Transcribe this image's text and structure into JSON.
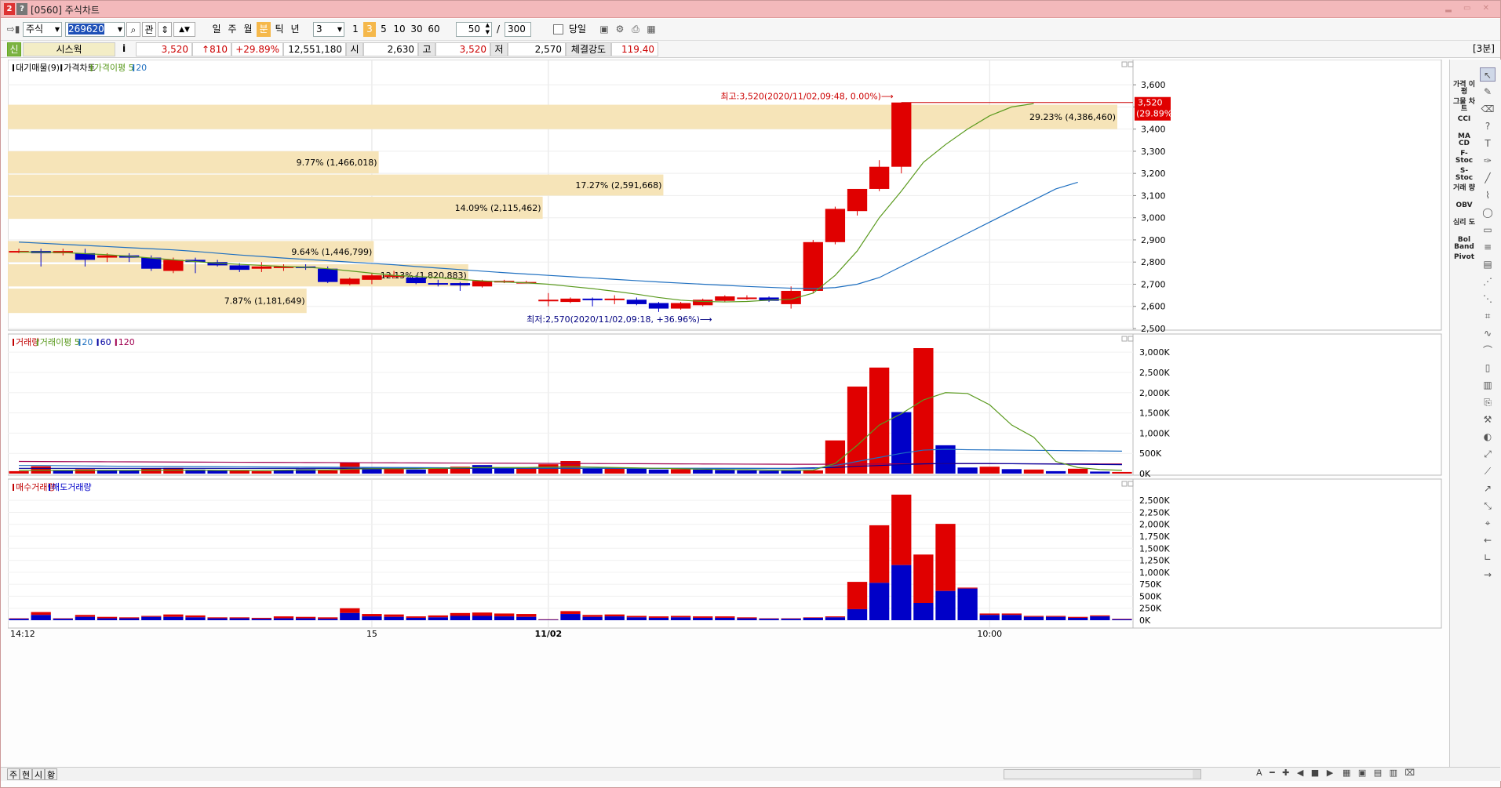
{
  "window": {
    "title": "[0560] 주식차트",
    "icon1": "2",
    "icon2": "?"
  },
  "toolbar": {
    "market": "주식",
    "code": "269620",
    "btn_kwan": "관",
    "periods": [
      "일",
      "주",
      "월",
      "분",
      "틱",
      "년"
    ],
    "period_selected": "분",
    "interval": "3",
    "minute_opts": [
      "1",
      "3",
      "5",
      "10",
      "30",
      "60"
    ],
    "minute_selected": "3",
    "display_count": "50",
    "slash": "/",
    "total_count": "300",
    "today_label": "당일"
  },
  "info": {
    "badge": "신",
    "name": "시스웍",
    "info_icon": "i",
    "price": "3,520",
    "change": "↑810",
    "change_pct": "+29.89%",
    "volume": "12,551,180",
    "open_label": "시",
    "open": "2,630",
    "high_label": "고",
    "high": "3,520",
    "low_label": "저",
    "low": "2,570",
    "strength_label": "체결강도",
    "strength": "119.40",
    "timeframe": "[3분]"
  },
  "chart_data": [
    {
      "type": "candlestick",
      "legend": [
        {
          "name": "대기매물(9)",
          "color": "#000000"
        },
        {
          "name": "가격차트",
          "color": "#000000"
        },
        {
          "name": "가격이평 5",
          "color": "#5a9a1e"
        },
        {
          "name": "20",
          "color": "#1e6fc0"
        }
      ],
      "ylim": [
        2500,
        3650
      ],
      "yticks": [
        "3,600",
        "3,500",
        "3,400",
        "3,300",
        "3,200",
        "3,100",
        "3,000",
        "2,900",
        "2,800",
        "2,700",
        "2,600",
        "2,500"
      ],
      "last_price_label": "3,520",
      "last_pct_label": "(29.89%)",
      "high_annotation": "최고:3,520(2020/11/02,09:48, 0.00%)⟶",
      "low_annotation": "최저:2,570(2020/11/02,09:18, +36.96%)⟶",
      "volume_profile": [
        {
          "label": "29.23% (4,386,460)",
          "low": 3400,
          "high": 3510
        },
        {
          "label": "9.77% (1,466,018)",
          "low": 3200,
          "high": 3300
        },
        {
          "label": "17.27% (2,591,668)",
          "low": 3100,
          "high": 3195
        },
        {
          "label": "14.09% (2,115,462)",
          "low": 2995,
          "high": 3095
        },
        {
          "label": "9.64% (1,446,799)",
          "low": 2800,
          "high": 2895
        },
        {
          "label": "12.13% (1,820,883)",
          "low": 2690,
          "high": 2790
        },
        {
          "label": "7.87% (1,181,649)",
          "low": 2570,
          "high": 2680
        }
      ],
      "candles": [
        {
          "o": 2850,
          "h": 2860,
          "l": 2840,
          "c": 2850
        },
        {
          "o": 2850,
          "h": 2860,
          "l": 2780,
          "c": 2840
        },
        {
          "o": 2840,
          "h": 2860,
          "l": 2830,
          "c": 2850
        },
        {
          "o": 2840,
          "h": 2860,
          "l": 2780,
          "c": 2810
        },
        {
          "o": 2820,
          "h": 2840,
          "l": 2800,
          "c": 2830
        },
        {
          "o": 2830,
          "h": 2840,
          "l": 2800,
          "c": 2820
        },
        {
          "o": 2820,
          "h": 2830,
          "l": 2760,
          "c": 2770
        },
        {
          "o": 2760,
          "h": 2820,
          "l": 2750,
          "c": 2810
        },
        {
          "o": 2810,
          "h": 2820,
          "l": 2750,
          "c": 2800
        },
        {
          "o": 2800,
          "h": 2810,
          "l": 2780,
          "c": 2785
        },
        {
          "o": 2785,
          "h": 2795,
          "l": 2755,
          "c": 2765
        },
        {
          "o": 2770,
          "h": 2800,
          "l": 2755,
          "c": 2780
        },
        {
          "o": 2780,
          "h": 2790,
          "l": 2760,
          "c": 2780
        },
        {
          "o": 2780,
          "h": 2790,
          "l": 2765,
          "c": 2775
        },
        {
          "o": 2770,
          "h": 2780,
          "l": 2705,
          "c": 2710
        },
        {
          "o": 2700,
          "h": 2730,
          "l": 2695,
          "c": 2725
        },
        {
          "o": 2720,
          "h": 2750,
          "l": 2700,
          "c": 2740
        },
        {
          "o": 2735,
          "h": 2760,
          "l": 2725,
          "c": 2740
        },
        {
          "o": 2730,
          "h": 2740,
          "l": 2700,
          "c": 2705
        },
        {
          "o": 2705,
          "h": 2720,
          "l": 2690,
          "c": 2700
        },
        {
          "o": 2705,
          "h": 2710,
          "l": 2670,
          "c": 2695
        },
        {
          "o": 2690,
          "h": 2720,
          "l": 2685,
          "c": 2715
        },
        {
          "o": 2710,
          "h": 2720,
          "l": 2705,
          "c": 2715
        },
        {
          "o": 2710,
          "h": 2715,
          "l": 2705,
          "c": 2710
        },
        {
          "o": 2630,
          "h": 2660,
          "l": 2600,
          "c": 2630
        },
        {
          "o": 2620,
          "h": 2640,
          "l": 2615,
          "c": 2635
        },
        {
          "o": 2635,
          "h": 2640,
          "l": 2600,
          "c": 2630
        },
        {
          "o": 2635,
          "h": 2650,
          "l": 2610,
          "c": 2635
        },
        {
          "o": 2630,
          "h": 2640,
          "l": 2605,
          "c": 2610
        },
        {
          "o": 2615,
          "h": 2620,
          "l": 2575,
          "c": 2590
        },
        {
          "o": 2590,
          "h": 2620,
          "l": 2585,
          "c": 2615
        },
        {
          "o": 2605,
          "h": 2635,
          "l": 2600,
          "c": 2630
        },
        {
          "o": 2625,
          "h": 2650,
          "l": 2620,
          "c": 2645
        },
        {
          "o": 2640,
          "h": 2650,
          "l": 2630,
          "c": 2640
        },
        {
          "o": 2640,
          "h": 2645,
          "l": 2620,
          "c": 2625
        },
        {
          "o": 2610,
          "h": 2690,
          "l": 2590,
          "c": 2670
        },
        {
          "o": 2670,
          "h": 2900,
          "l": 2660,
          "c": 2890
        },
        {
          "o": 2890,
          "h": 3050,
          "l": 2880,
          "c": 3040
        },
        {
          "o": 3030,
          "h": 3120,
          "l": 3010,
          "c": 3130
        },
        {
          "o": 3130,
          "h": 3260,
          "l": 3120,
          "c": 3230
        },
        {
          "o": 3230,
          "h": 3520,
          "l": 3200,
          "c": 3520
        }
      ],
      "ma5": [
        2845,
        2845,
        2843,
        2838,
        2833,
        2826,
        2818,
        2810,
        2802,
        2795,
        2790,
        2785,
        2780,
        2777,
        2770,
        2760,
        2750,
        2740,
        2735,
        2730,
        2722,
        2715,
        2710,
        2706,
        2700,
        2690,
        2680,
        2668,
        2655,
        2640,
        2628,
        2622,
        2620,
        2622,
        2628,
        2632,
        2660,
        2740,
        2850,
        3000,
        3120,
        3250,
        3330,
        3400,
        3460,
        3500,
        3515
      ],
      "ma20": [
        2890,
        2885,
        2880,
        2875,
        2870,
        2865,
        2860,
        2855,
        2848,
        2840,
        2832,
        2825,
        2818,
        2812,
        2806,
        2800,
        2794,
        2788,
        2780,
        2773,
        2766,
        2759,
        2752,
        2746,
        2740,
        2734,
        2728,
        2722,
        2716,
        2710,
        2705,
        2700,
        2695,
        2690,
        2686,
        2682,
        2680,
        2685,
        2700,
        2730,
        2780,
        2830,
        2880,
        2930,
        2980,
        3030,
        3080,
        3130,
        3160
      ]
    },
    {
      "type": "bar",
      "legend": [
        {
          "name": "거래량",
          "color": "#c00000"
        },
        {
          "name": "거래이평 5",
          "color": "#5a9a1e"
        },
        {
          "name": "20",
          "color": "#1e6fc0"
        },
        {
          "name": "60",
          "color": "#0000a0"
        },
        {
          "name": "120",
          "color": "#a00050"
        }
      ],
      "ylim": [
        0,
        3100000
      ],
      "yticks": [
        "3,000K",
        "2,500K",
        "2,000K",
        "1,500K",
        "1,000K",
        "500K",
        "0K"
      ],
      "values": [
        60000,
        180000,
        70000,
        110000,
        90000,
        80000,
        130000,
        140000,
        100000,
        80000,
        70000,
        60000,
        90000,
        110000,
        80000,
        270000,
        140000,
        130000,
        100000,
        120000,
        170000,
        210000,
        130000,
        150000,
        230000,
        310000,
        140000,
        140000,
        120000,
        100000,
        110000,
        100000,
        90000,
        80000,
        70000,
        70000,
        80000,
        820000,
        2150000,
        2620000,
        1520000,
        3100000,
        700000,
        150000,
        170000,
        110000,
        100000,
        60000,
        120000,
        50000,
        40000
      ],
      "ups": [
        1,
        1,
        0,
        1,
        0,
        0,
        1,
        1,
        0,
        0,
        1,
        1,
        0,
        0,
        1,
        1,
        0,
        1,
        0,
        1,
        1,
        0,
        0,
        1,
        1,
        1,
        0,
        1,
        0,
        0,
        1,
        0,
        0,
        0,
        0,
        0,
        1,
        1,
        1,
        1,
        0,
        1,
        0,
        0,
        1,
        0,
        1,
        0,
        1,
        0,
        1
      ],
      "ma5": [
        80000,
        80000,
        80000,
        80000,
        80000,
        80000,
        85000,
        85000,
        85000,
        80000,
        80000,
        80000,
        85000,
        90000,
        90000,
        110000,
        120000,
        120000,
        120000,
        130000,
        140000,
        150000,
        150000,
        150000,
        160000,
        170000,
        160000,
        150000,
        140000,
        130000,
        120000,
        110000,
        100000,
        95000,
        85000,
        80000,
        85000,
        250000,
        700000,
        1200000,
        1480000,
        1820000,
        2000000,
        1980000,
        1700000,
        1200000,
        900000,
        300000,
        150000,
        100000,
        80000
      ],
      "ma20": [
        200000,
        200000,
        195000,
        190000,
        185000,
        180000,
        178000,
        175000,
        172000,
        170000,
        168000,
        165000,
        162000,
        160000,
        158000,
        155000,
        152000,
        150000,
        148000,
        145000,
        142000,
        140000,
        138000,
        136000,
        135000,
        134000,
        133000,
        132000,
        131000,
        130000,
        129000,
        128000,
        127000,
        126000,
        125000,
        124000,
        124000,
        200000,
        300000,
        400000,
        500000,
        580000,
        600000,
        590000,
        585000,
        580000,
        575000,
        570000,
        565000,
        560000,
        555000
      ],
      "ma60": [
        130000,
        130000,
        130000,
        130000,
        130000,
        130000,
        130000,
        130000,
        130000,
        130000,
        130000,
        130000,
        130000,
        130000,
        130000,
        130000,
        130000,
        130000,
        130000,
        130000,
        130000,
        130000,
        130000,
        130000,
        130000,
        130000,
        130000,
        130000,
        130000,
        130000,
        130000,
        130000,
        130000,
        130000,
        130000,
        130000,
        140000,
        150000,
        180000,
        200000,
        220000,
        240000,
        250000,
        250000,
        250000,
        245000,
        240000,
        235000,
        230000,
        225000,
        220000
      ],
      "ma120": [
        300000,
        298000,
        296000,
        294000,
        292000,
        290000,
        288000,
        286000,
        284000,
        282000,
        280000,
        278000,
        276000,
        274000,
        272000,
        270000,
        268000,
        266000,
        264000,
        262000,
        260000,
        258000,
        256000,
        254000,
        252000,
        250000,
        248000,
        246000,
        244000,
        242000,
        240000,
        238000,
        236000,
        234000,
        232000,
        230000,
        230000,
        232000,
        235000,
        238000,
        240000,
        242000,
        244000,
        244000,
        244000,
        243000,
        242000,
        241000,
        240000,
        239000,
        238000
      ]
    },
    {
      "type": "bar",
      "legend": [
        {
          "name": "매수거래량",
          "color": "#c00000"
        },
        {
          "name": "매도거래량",
          "color": "#0000c8"
        }
      ],
      "ylim": [
        0,
        2650000
      ],
      "yticks": [
        "2,500K",
        "2,250K",
        "2,000K",
        "1,750K",
        "1,500K",
        "1,250K",
        "1,000K",
        "750K",
        "500K",
        "250K",
        "0K"
      ],
      "buy": [
        10000,
        60000,
        10000,
        40000,
        30000,
        20000,
        20000,
        50000,
        40000,
        20000,
        20000,
        20000,
        40000,
        30000,
        30000,
        100000,
        50000,
        50000,
        30000,
        40000,
        60000,
        70000,
        60000,
        60000,
        10000,
        60000,
        40000,
        40000,
        30000,
        30000,
        30000,
        30000,
        30000,
        20000,
        10000,
        10000,
        10000,
        20000,
        570000,
        1200000,
        1470000,
        1010000,
        1400000,
        20000,
        30000,
        30000,
        20000,
        20000,
        20000,
        20000,
        10000
      ],
      "sell": [
        30000,
        110000,
        30000,
        70000,
        40000,
        40000,
        70000,
        70000,
        60000,
        40000,
        40000,
        30000,
        40000,
        40000,
        30000,
        150000,
        80000,
        70000,
        50000,
        60000,
        90000,
        90000,
        80000,
        70000,
        10000,
        130000,
        70000,
        80000,
        60000,
        50000,
        60000,
        50000,
        50000,
        40000,
        30000,
        30000,
        50000,
        60000,
        230000,
        780000,
        1150000,
        360000,
        610000,
        660000,
        110000,
        110000,
        70000,
        70000,
        50000,
        80000,
        20000
      ],
      "x_labels": [
        {
          "label": "14:12",
          "index": 0
        },
        {
          "label": "15",
          "index": 16
        },
        {
          "label": "11/02",
          "index": 24
        },
        {
          "label": "10:00",
          "index": 44
        }
      ]
    }
  ],
  "rtools": {
    "indicators": [
      "가격 이평",
      "그물 차트",
      "CCI",
      "MA CD",
      "F- Stoc",
      "S- Stoc",
      "거래 량",
      "OBV",
      "심리 도",
      "Bol Band",
      "Pivot"
    ]
  },
  "bottom": {
    "tabs": [
      "주",
      "현",
      "시",
      "황"
    ]
  }
}
